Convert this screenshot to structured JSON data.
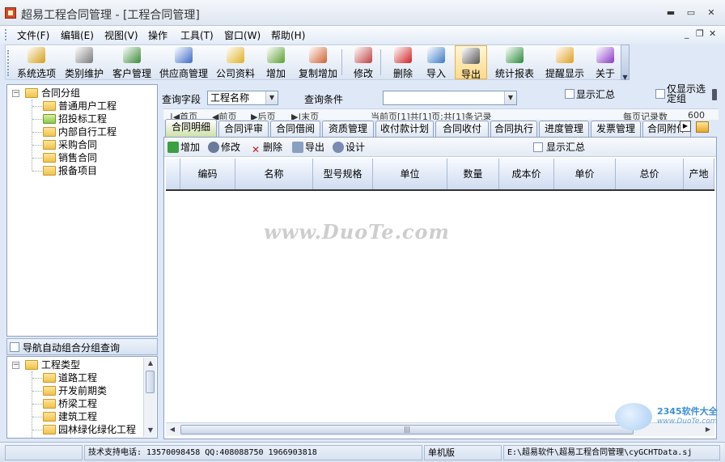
{
  "window": {
    "title": "超易工程合同管理 - [工程合同管理]",
    "controls": {
      "minimize": "▬",
      "maximize": "▭",
      "close": "✕"
    }
  },
  "menu": {
    "items": [
      "文件(F)",
      "编辑(E)",
      "视图(V)",
      "操作",
      "工具(T)",
      "窗口(W)",
      "帮助(H)"
    ],
    "mdi_controls": {
      "minimize": "_",
      "restore": "❐",
      "close": "✕"
    }
  },
  "toolbar": {
    "buttons": [
      {
        "label": "系统选项",
        "icon": "hammer-icon",
        "color": "#d4a017"
      },
      {
        "label": "类别维护",
        "icon": "tools-icon",
        "color": "#7a7a7a"
      },
      {
        "label": "客户管理",
        "icon": "globe-user-icon",
        "color": "#3a8a3a"
      },
      {
        "label": "供应商管理",
        "icon": "user-icon",
        "color": "#3a6ac8"
      },
      {
        "label": "公司资料",
        "icon": "coins-icon",
        "color": "#e0b020"
      },
      {
        "label": "增加",
        "icon": "user-add-icon",
        "color": "#5aa030"
      },
      {
        "label": "复制增加",
        "icon": "copy-add-icon",
        "color": "#d06030"
      },
      {
        "label": "修改",
        "icon": "pencil-icon",
        "color": "#c04040"
      },
      {
        "label": "删除",
        "icon": "delete-x-icon",
        "color": "#d02020"
      },
      {
        "label": "导入",
        "icon": "import-icon",
        "color": "#3a7ac8"
      },
      {
        "label": "导出",
        "icon": "printer-export-icon",
        "color": "#555555"
      },
      {
        "label": "统计报表",
        "icon": "bar-chart-icon",
        "color": "#2a8a3a"
      },
      {
        "label": "提醒显示",
        "icon": "alert-doc-icon",
        "color": "#e0a020"
      },
      {
        "label": "关于",
        "icon": "question-icon",
        "color": "#8a3ac8"
      }
    ],
    "active_index": 10
  },
  "tree_groups": {
    "root": "合同分组",
    "children": [
      "普通用户工程",
      "招投标工程",
      "内部自行工程",
      "采购合同",
      "销售合同",
      "报备项目"
    ],
    "selected_index": 1
  },
  "nav_auto_group": {
    "label": "导航自动组合分组查询",
    "checked": false
  },
  "tree_types": {
    "root": "工程类型",
    "children": [
      "道路工程",
      "开发前期类",
      "桥梁工程",
      "建筑工程",
      "园林绿化绿化工程"
    ]
  },
  "query": {
    "field_label": "查询字段",
    "field_value": "工程名称",
    "condition_label": "查询条件",
    "condition_value": "",
    "show_summary_label": "显示汇总",
    "only_show_label": "仅显示选定组"
  },
  "pager": {
    "items": [
      "|◀首页",
      "◀前页",
      "▶后页",
      "▶|末页"
    ],
    "status": "当前页[1]共[1]页;共[1]条记录",
    "per_page_label": "每页记录数",
    "per_page_value": "600"
  },
  "tabs": [
    "合同明细",
    "合同评审",
    "合同借阅",
    "资质管理",
    "收付款计划",
    "合同收付",
    "合同执行",
    "进度管理",
    "发票管理",
    "合同附件"
  ],
  "active_tab": 0,
  "sub_toolbar": {
    "add": "增加",
    "edit": "修改",
    "delete": "删除",
    "export": "导出",
    "design": "设计",
    "show_summary": "显示汇总"
  },
  "grid_columns": [
    "编码",
    "名称",
    "型号规格",
    "单位",
    "数量",
    "成本价",
    "单价",
    "总价",
    "产地"
  ],
  "watermark": "www.DuoTe.com",
  "corner_logo": {
    "name": "2345软件大全",
    "url": "www.DuoTe.com"
  },
  "status": {
    "support": "技术支持电话: 13570098458 QQ:408088750 1966903818",
    "edition": "单机版",
    "path": "E:\\超易软件\\超易工程合同管理\\cyGCHTData.sj"
  }
}
